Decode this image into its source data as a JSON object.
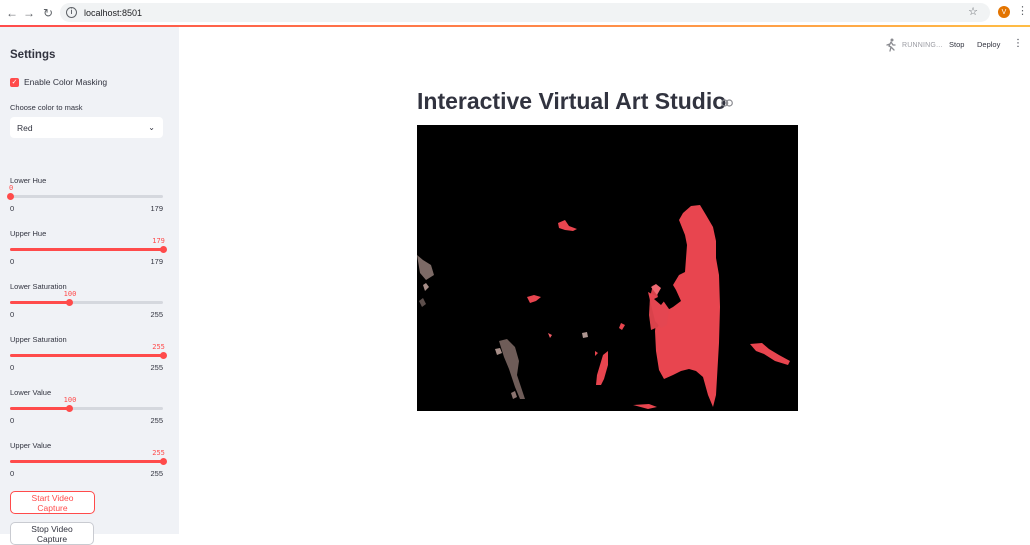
{
  "browser": {
    "url": "localhost:8501",
    "profile_initial": "V"
  },
  "header": {
    "status": "RUNNING...",
    "stop_label": "Stop",
    "deploy_label": "Deploy"
  },
  "sidebar": {
    "title": "Settings",
    "color_masking": {
      "label": "Enable Color Masking",
      "checked": true
    },
    "color_select": {
      "label": "Choose color to mask",
      "value": "Red"
    },
    "sliders": [
      {
        "label": "Lower Hue",
        "value": "0",
        "min": "0",
        "max": "179",
        "fraction": 0.0
      },
      {
        "label": "Upper Hue",
        "value": "179",
        "min": "0",
        "max": "179",
        "fraction": 1.0
      },
      {
        "label": "Lower Saturation",
        "value": "100",
        "min": "0",
        "max": "255",
        "fraction": 0.392
      },
      {
        "label": "Upper Saturation",
        "value": "255",
        "min": "0",
        "max": "255",
        "fraction": 1.0
      },
      {
        "label": "Lower Value",
        "value": "100",
        "min": "0",
        "max": "255",
        "fraction": 0.392
      },
      {
        "label": "Upper Value",
        "value": "255",
        "min": "0",
        "max": "255",
        "fraction": 1.0
      }
    ],
    "start_button": "Start Video Capture",
    "stop_button": "Stop Video Capture"
  },
  "main": {
    "title": "Interactive Virtual Art Studio"
  },
  "colors": {
    "accent": "#ff4b4b",
    "sidebar_bg": "#f0f2f6",
    "text": "#31333f",
    "mask_red": "#e8454f"
  }
}
